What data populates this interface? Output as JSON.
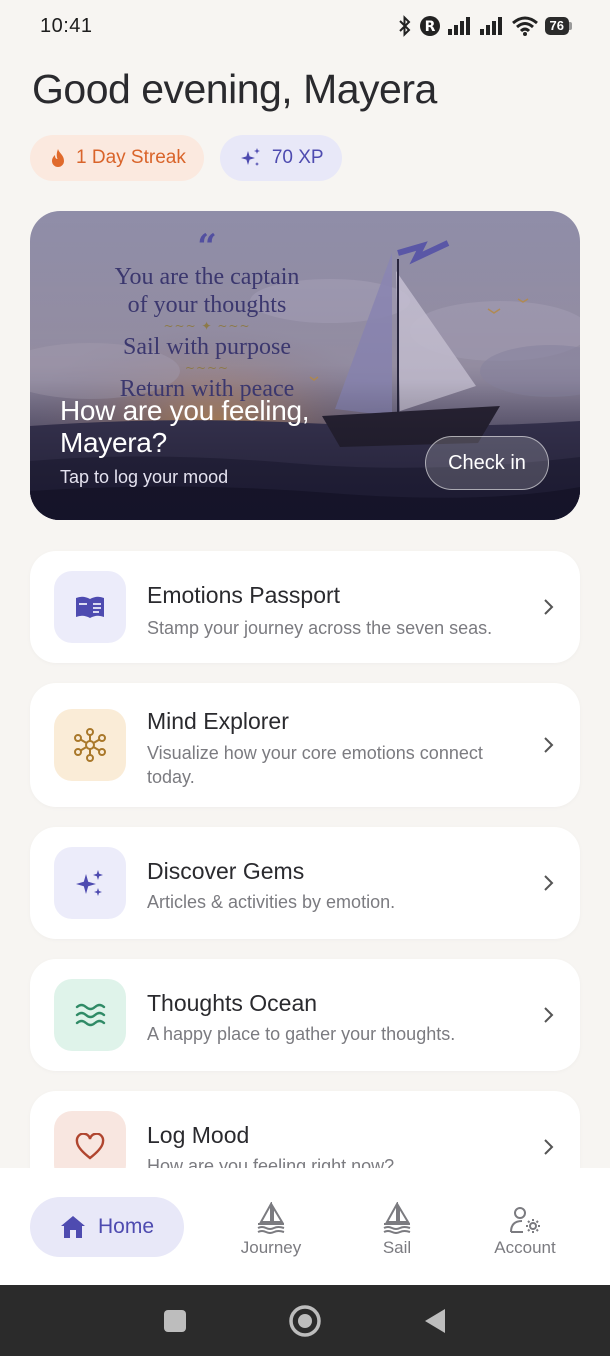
{
  "status_bar": {
    "time": "10:41",
    "battery": "76"
  },
  "greeting": "Good evening, Mayera",
  "pills": {
    "streak": "1 Day Streak",
    "xp": "70 XP"
  },
  "hero": {
    "quote_lines": [
      "You are the captain",
      "of your thoughts",
      "Sail with purpose",
      "Return with peace"
    ],
    "title_line1": "How are you feeling,",
    "title_line2": "Mayera?",
    "subtitle": "Tap to log your mood",
    "button": "Check in"
  },
  "cards": [
    {
      "title": "Emotions Passport",
      "desc": "Stamp your journey across the seven seas.",
      "icon": "passport-book-icon",
      "icon_bg": "#ececfa",
      "icon_color": "#4e4bb0"
    },
    {
      "title": "Mind Explorer",
      "desc": "Visualize how your core emotions connect today.",
      "icon": "network-icon",
      "icon_bg": "#faecd7",
      "icon_color": "#a9782a"
    },
    {
      "title": "Discover Gems",
      "desc": "Articles & activities by emotion.",
      "icon": "sparkles-icon",
      "icon_bg": "#ececfa",
      "icon_color": "#4e4bb0"
    },
    {
      "title": "Thoughts Ocean",
      "desc": "A happy place to gather your thoughts.",
      "icon": "waves-icon",
      "icon_bg": "#dff3ea",
      "icon_color": "#2f8a66"
    },
    {
      "title": "Log Mood",
      "desc": "How are you feeling right now?",
      "icon": "heart-icon",
      "icon_bg": "#f8e6e0",
      "icon_color": "#b0452f"
    }
  ],
  "nav": {
    "home": "Home",
    "journey": "Journey",
    "sail": "Sail",
    "account": "Account"
  }
}
